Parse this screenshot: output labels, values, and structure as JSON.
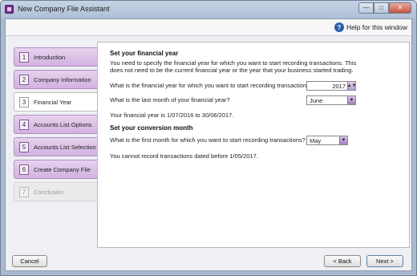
{
  "window": {
    "title": "New Company File Assistant",
    "controls": {
      "minimize": "—",
      "maximize": "□",
      "close": "✕"
    }
  },
  "help": {
    "label": "Help for this window",
    "icon": "?"
  },
  "steps": [
    {
      "number": "1",
      "label": "Introduction",
      "state": "done"
    },
    {
      "number": "2",
      "label": "Company Information",
      "state": "done"
    },
    {
      "number": "3",
      "label": "Financial Year",
      "state": "active"
    },
    {
      "number": "4",
      "label": "Accounts List Options",
      "state": "pending"
    },
    {
      "number": "5",
      "label": "Accounts List Selection",
      "state": "pending"
    },
    {
      "number": "6",
      "label": "Create Company File",
      "state": "pending"
    },
    {
      "number": "7",
      "label": "Conclusion",
      "state": "disabled"
    }
  ],
  "content": {
    "section1": {
      "heading": "Set your financial year",
      "intro_line1": "You need to specify the financial year for which you want to start recording transactions. This",
      "intro_line2": "does not need to be the current financial year or the year that your business started trading.",
      "year_question": "What is the financial year for which you want to start recording transactions?",
      "year_value": "2017",
      "month_question": "What is the last month of your financial year?",
      "month_value": "June",
      "summary": "Your financial year is 1/07/2016 to 30/06/2017."
    },
    "section2": {
      "heading": "Set your conversion month",
      "question": "What is the first month for which you want to start recording transactions?",
      "month_value": "May",
      "note": "You cannot record transactions dated before 1/05/2017."
    }
  },
  "footer": {
    "cancel": "Cancel",
    "back": "< Back",
    "next": "Next >"
  },
  "colors": {
    "accent_purple": "#d2b2e0",
    "titlebar_blue": "#aebfd6",
    "close_red": "#c5523f"
  }
}
